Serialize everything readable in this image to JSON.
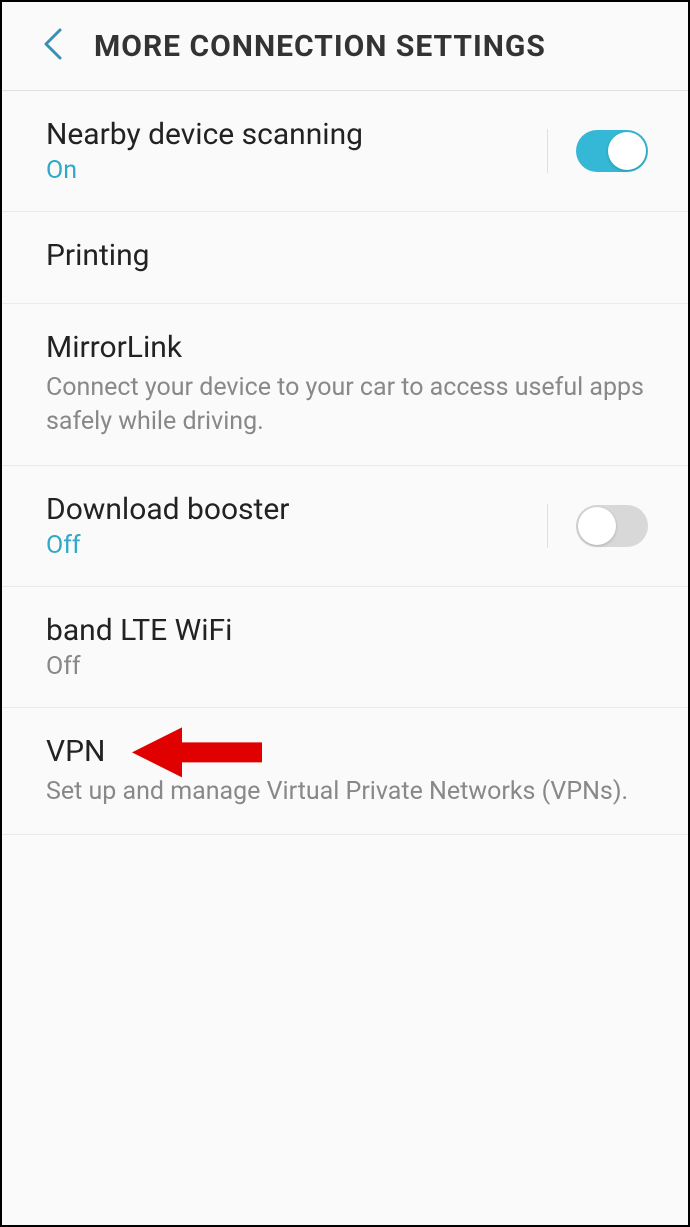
{
  "header": {
    "title": "MORE CONNECTION SETTINGS"
  },
  "settings": {
    "nearby": {
      "title": "Nearby device scanning",
      "status": "On",
      "toggle": true
    },
    "printing": {
      "title": "Printing"
    },
    "mirrorlink": {
      "title": "MirrorLink",
      "description": "Connect your device to your car to access useful apps safely while driving."
    },
    "download_booster": {
      "title": "Download booster",
      "status": "Off",
      "toggle": false
    },
    "band_lte": {
      "title": "band LTE WiFi",
      "status": "Off"
    },
    "vpn": {
      "title": "VPN",
      "description": "Set up and manage Virtual Private Networks (VPNs)."
    }
  }
}
